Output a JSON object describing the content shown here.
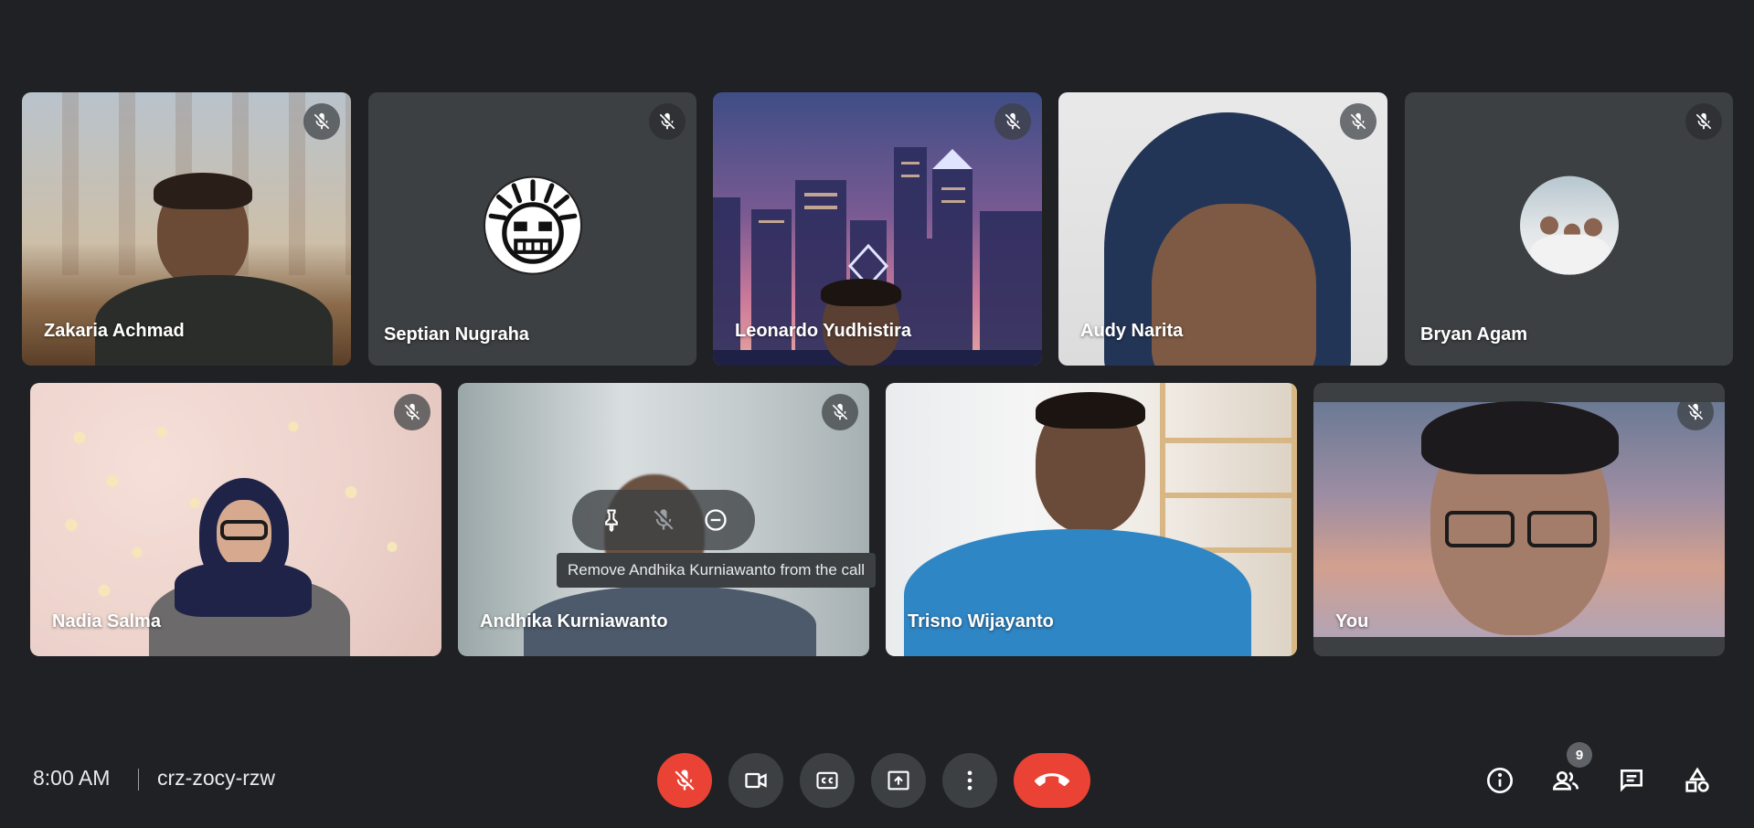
{
  "participants": [
    {
      "name": "Zakaria Achmad"
    },
    {
      "name": "Septian Nugraha"
    },
    {
      "name": "Leonardo Yudhistira"
    },
    {
      "name": "Audy Narita"
    },
    {
      "name": "Bryan Agam"
    },
    {
      "name": "Nadia Salma"
    },
    {
      "name": "Andhika Kurniawanto"
    },
    {
      "name": "Trisno Wijayanto"
    },
    {
      "name": "You"
    }
  ],
  "hover": {
    "tooltip": "Remove Andhika Kurniawanto from the call"
  },
  "footer": {
    "time": "8:00 AM",
    "meeting_code": "crz-zocy-rzw",
    "participants_count": "9"
  },
  "icons": {
    "mute": "mic-off-icon",
    "camera": "videocam-icon",
    "captions": "closed-caption-icon",
    "present": "present-to-all-icon",
    "more": "more-vert-icon",
    "end": "call-end-icon",
    "info": "info-icon",
    "people": "people-icon",
    "chat": "chat-icon",
    "activities": "activities-icon",
    "pin": "pin-icon",
    "remove": "remove-circle-icon"
  },
  "colors": {
    "background": "#202124",
    "tile": "#3c4043",
    "danger": "#ea4335"
  }
}
